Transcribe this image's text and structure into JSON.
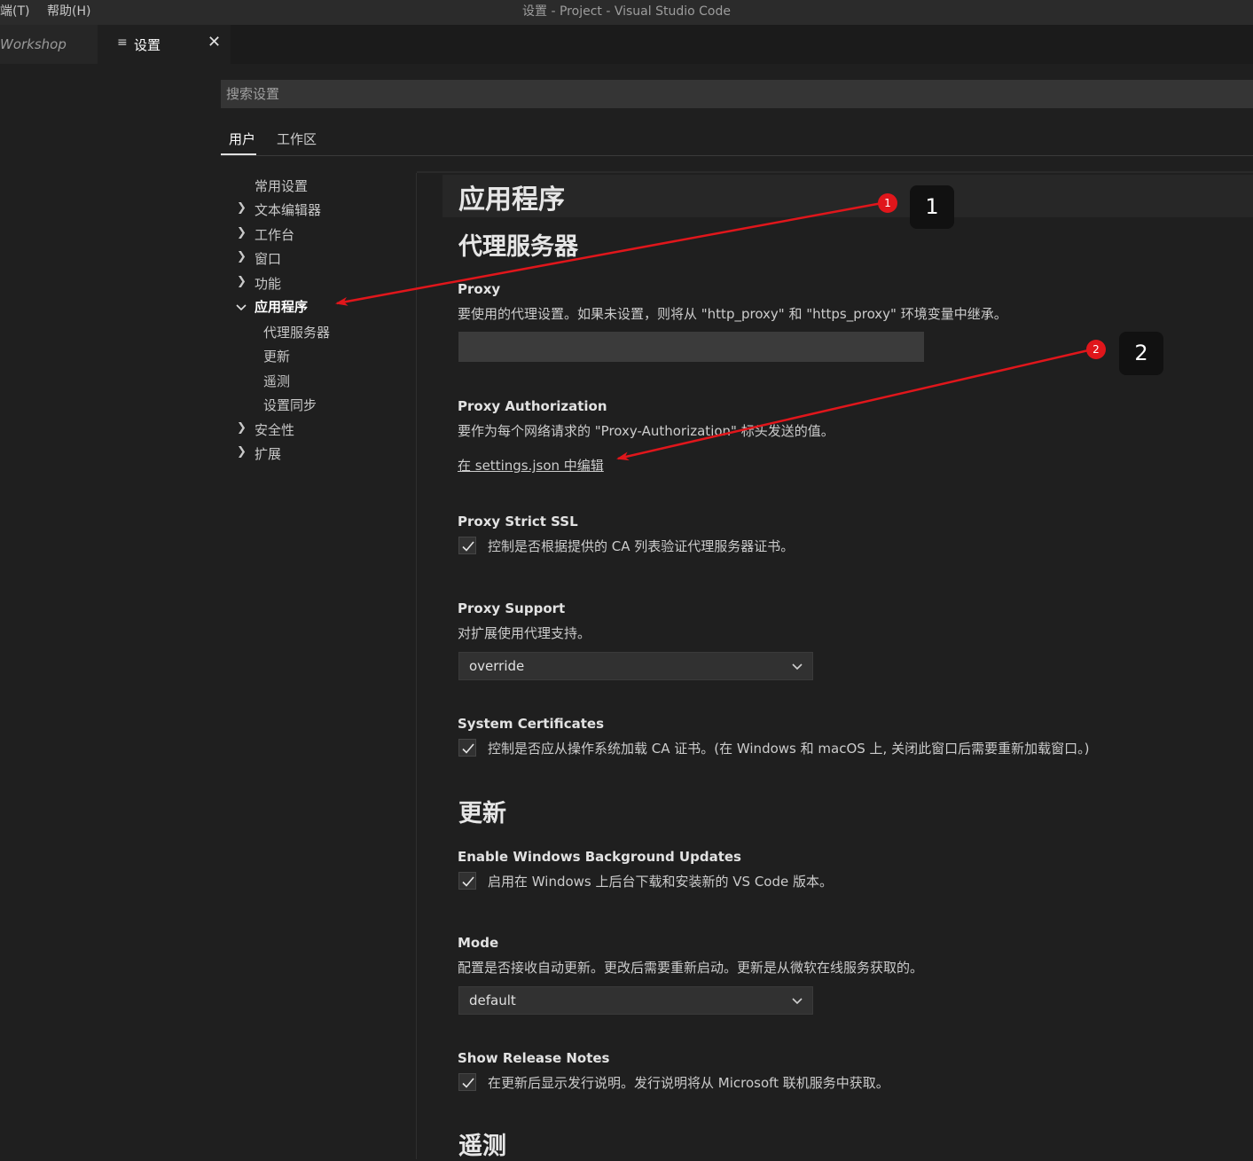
{
  "titlebar": {
    "menu": [
      "端(T)",
      "帮助(H)"
    ],
    "title": "设置 - Project - Visual Studio Code"
  },
  "tabs": [
    {
      "label": "Workshop"
    },
    {
      "label": "设置",
      "icon": "settings-list-icon",
      "close": "✕"
    }
  ],
  "search": {
    "placeholder": "搜索设置"
  },
  "scopes": [
    "用户",
    "工作区"
  ],
  "toc": {
    "items": [
      "常用设置",
      "文本编辑器",
      "工作台",
      "窗口",
      "功能",
      "应用程序",
      "代理服务器",
      "更新",
      "遥测",
      "设置同步",
      "安全性",
      "扩展"
    ]
  },
  "content": {
    "category": "应用程序",
    "section_proxy": "代理服务器",
    "proxy": {
      "title": "Proxy",
      "desc": "要使用的代理设置。如果未设置，则将从 \"http_proxy\" 和 \"https_proxy\" 环境变量中继承。",
      "value": ""
    },
    "proxy_auth": {
      "title": "Proxy Authorization",
      "desc": "要作为每个网络请求的 \"Proxy-Authorization\" 标头发送的值。",
      "link": "在 settings.json 中编辑"
    },
    "proxy_ssl": {
      "title": "Proxy Strict SSL",
      "desc": "控制是否根据提供的 CA 列表验证代理服务器证书。",
      "checked": true
    },
    "proxy_support": {
      "title": "Proxy Support",
      "desc": "对扩展使用代理支持。",
      "value": "override"
    },
    "system_certs": {
      "title": "System Certificates",
      "desc": "控制是否应从操作系统加载 CA 证书。(在 Windows 和 macOS 上, 关闭此窗口后需要重新加载窗口。)",
      "checked": true
    },
    "section_update": "更新",
    "win_bg_updates": {
      "title": "Enable Windows Background Updates",
      "desc": "启用在 Windows 上后台下载和安装新的 VS Code 版本。",
      "checked": true
    },
    "mode": {
      "title": "Mode",
      "desc": "配置是否接收自动更新。更改后需要重新启动。更新是从微软在线服务获取的。",
      "value": "default"
    },
    "release_notes": {
      "title": "Show Release Notes",
      "desc": "在更新后显示发行说明。发行说明将从 Microsoft 联机服务中获取。",
      "checked": true
    },
    "section_telemetry": "遥测"
  },
  "annotations": [
    {
      "number": "1",
      "badge": "1"
    },
    {
      "number": "2",
      "badge": "2"
    }
  ],
  "colors": {
    "background": "#1f1f1f",
    "annotation_red": "#e0161b",
    "callout_bg": "#111111"
  }
}
